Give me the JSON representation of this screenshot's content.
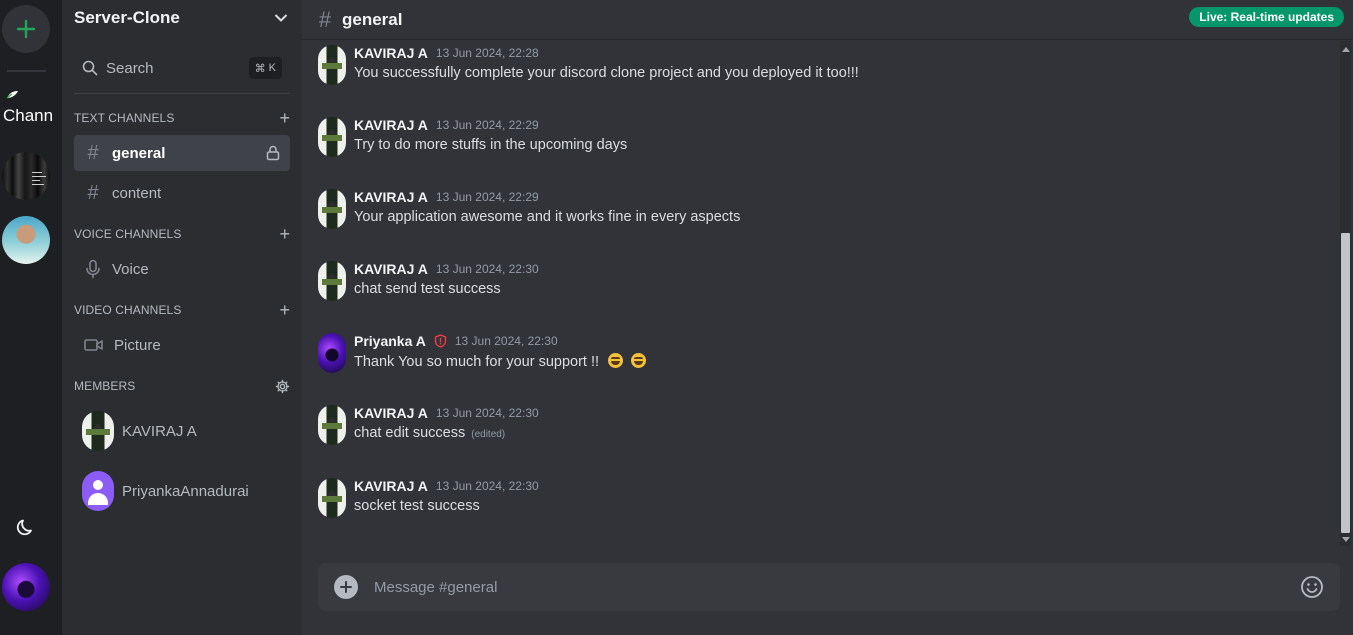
{
  "rail": {
    "server_label": "Chann"
  },
  "sidebar": {
    "server_name": "Server-Clone",
    "search_label": "Search",
    "search_shortcut_key": "K",
    "categories": {
      "text": "TEXT CHANNELS",
      "voice": "VOICE CHANNELS",
      "video": "VIDEO CHANNELS",
      "members": "MEMBERS"
    },
    "channels": {
      "general": "general",
      "content": "content",
      "voice": "Voice",
      "picture": "Picture"
    },
    "members": [
      {
        "name": "KAVIRAJ A"
      },
      {
        "name": "PriyankaAnnadurai"
      }
    ]
  },
  "header": {
    "channel": "general",
    "live_badge": "Live: Real-time updates",
    "live_color": "#059669"
  },
  "messages": [
    {
      "author": "KAVIRAJ A",
      "time": "13 Jun 2024, 22:28",
      "text": "You successfully complete your discord clone project and you deployed it too!!!"
    },
    {
      "author": "KAVIRAJ A",
      "time": "13 Jun 2024, 22:29",
      "text": "Try to do more stuffs in the upcoming days"
    },
    {
      "author": "KAVIRAJ A",
      "time": "13 Jun 2024, 22:29",
      "text": "Your application awesome and it works fine in every aspects"
    },
    {
      "author": "KAVIRAJ A",
      "time": "13 Jun 2024, 22:30",
      "text": "chat send test success"
    },
    {
      "author": "Priyanka A",
      "time": "13 Jun 2024, 22:30",
      "text": "Thank You so much for your support !!"
    },
    {
      "author": "KAVIRAJ A",
      "time": "13 Jun 2024, 22:30",
      "text": "chat edit success",
      "edited": "(edited)"
    },
    {
      "author": "KAVIRAJ A",
      "time": "13 Jun 2024, 22:30",
      "text": "socket test success"
    }
  ],
  "composer": {
    "placeholder": "Message #general"
  }
}
